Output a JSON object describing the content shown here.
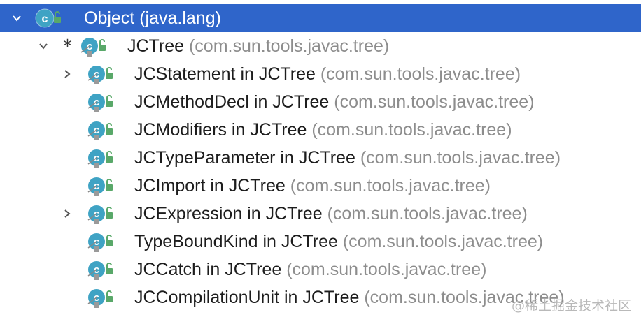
{
  "tree": {
    "root": {
      "name": "Object",
      "package": "(java.lang)"
    },
    "jctree": {
      "marker": "*",
      "name": "JCTree",
      "package": "(com.sun.tools.javac.tree)"
    },
    "children": [
      {
        "name": "JCStatement in JCTree",
        "package": "(com.sun.tools.javac.tree)",
        "expandable": true
      },
      {
        "name": "JCMethodDecl in JCTree",
        "package": "(com.sun.tools.javac.tree)",
        "expandable": false
      },
      {
        "name": "JCModifiers in JCTree",
        "package": "(com.sun.tools.javac.tree)",
        "expandable": false
      },
      {
        "name": "JCTypeParameter in JCTree",
        "package": "(com.sun.tools.javac.tree)",
        "expandable": false
      },
      {
        "name": "JCImport in JCTree",
        "package": "(com.sun.tools.javac.tree)",
        "expandable": false
      },
      {
        "name": "JCExpression in JCTree",
        "package": "(com.sun.tools.javac.tree)",
        "expandable": true
      },
      {
        "name": "TypeBoundKind in JCTree",
        "package": "(com.sun.tools.javac.tree)",
        "expandable": false
      },
      {
        "name": "JCCatch in JCTree",
        "package": "(com.sun.tools.javac.tree)",
        "expandable": false
      },
      {
        "name": "JCCompilationUnit in JCTree",
        "package": "(com.sun.tools.javac.tree)",
        "expandable": false
      }
    ]
  },
  "colors": {
    "selection": "#2f65ca",
    "package_text": "#8d8d8d",
    "class_icon": "#3fa3c4",
    "lock_icon": "#59a869"
  },
  "icons": {
    "class": "class-icon",
    "lock": "lock-icon",
    "chevron_down": "chevron-down-icon",
    "chevron_right": "chevron-right-icon"
  },
  "watermark": "@稀土掘金技术社区"
}
